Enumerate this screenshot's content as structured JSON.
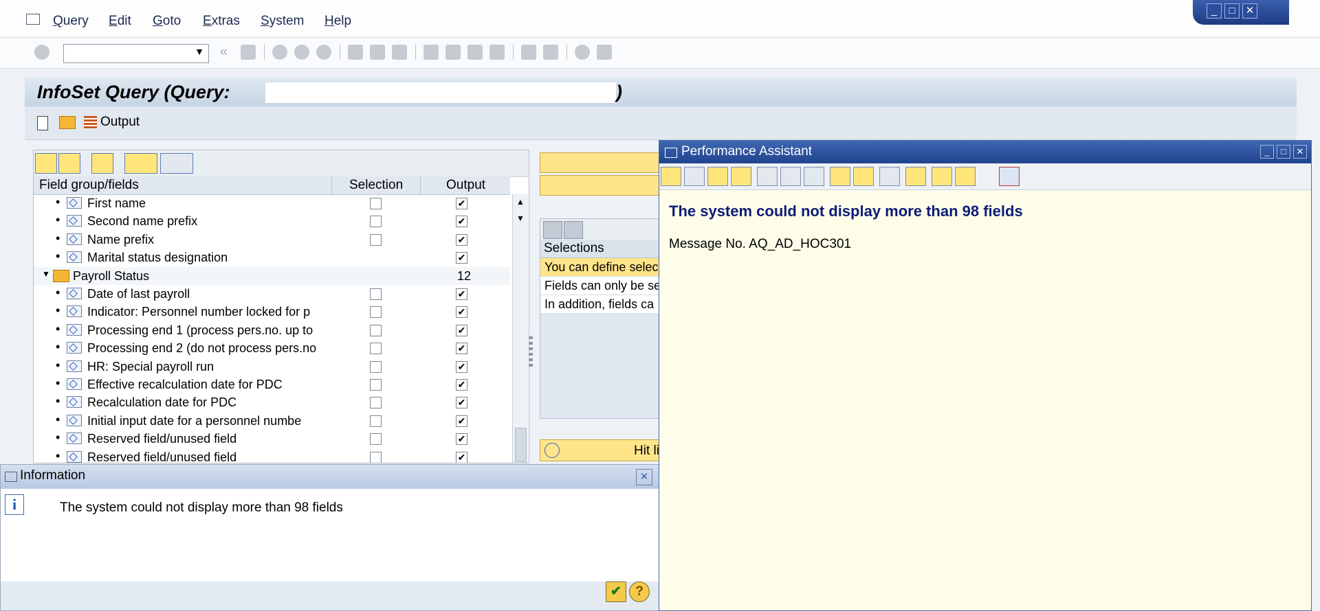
{
  "menu": [
    "Query",
    "Edit",
    "Goto",
    "Extras",
    "System",
    "Help"
  ],
  "page_title": "InfoSet Query (Query:",
  "page_title_end": ")",
  "app_toolbar": {
    "output_label": "Output"
  },
  "tree": {
    "headers": {
      "fields": "Field group/fields",
      "selection": "Selection",
      "output": "Output"
    },
    "rows": [
      {
        "label": "First name",
        "type": "field",
        "sel": false,
        "out": true
      },
      {
        "label": "Second name prefix",
        "type": "field",
        "sel": false,
        "out": true
      },
      {
        "label": "Name prefix",
        "type": "field",
        "sel": false,
        "out": true
      },
      {
        "label": "Marital status designation",
        "type": "field",
        "sel": null,
        "out": true
      },
      {
        "label": "Payroll Status",
        "type": "group",
        "count": "12"
      },
      {
        "label": "Date of last payroll",
        "type": "field",
        "sel": false,
        "out": true
      },
      {
        "label": "Indicator: Personnel number locked for p",
        "type": "field",
        "sel": false,
        "out": true
      },
      {
        "label": "Processing end 1 (process pers.no. up to",
        "type": "field",
        "sel": false,
        "out": true
      },
      {
        "label": "Processing end 2 (do not process pers.no",
        "type": "field",
        "sel": false,
        "out": true
      },
      {
        "label": "HR: Special payroll run",
        "type": "field",
        "sel": false,
        "out": true
      },
      {
        "label": "Effective recalculation date for PDC",
        "type": "field",
        "sel": false,
        "out": true
      },
      {
        "label": "Recalculation date for PDC",
        "type": "field",
        "sel": false,
        "out": true
      },
      {
        "label": "Initial input date for a personnel numbe",
        "type": "field",
        "sel": false,
        "out": true
      },
      {
        "label": "Reserved field/unused field",
        "type": "field",
        "sel": false,
        "out": true
      },
      {
        "label": "Reserved field/unused field",
        "type": "field",
        "sel": false,
        "out": true
      }
    ]
  },
  "selections": {
    "header": "Selections",
    "rows": [
      "You can define selec",
      "Fields can only be se",
      "In addition, fields ca"
    ],
    "hitlist_label": "Hit li"
  },
  "info_dialog": {
    "title": "Information",
    "message": "The system could not display more than 98 fields"
  },
  "performance_assistant": {
    "title": "Performance Assistant",
    "heading": "The system could not display more than 98 fields",
    "message": "Message No. AQ_AD_HOC301"
  },
  "colors": {
    "accent": "#21438d",
    "highlight": "#ffe48a",
    "pa_background": "#fefde9"
  }
}
